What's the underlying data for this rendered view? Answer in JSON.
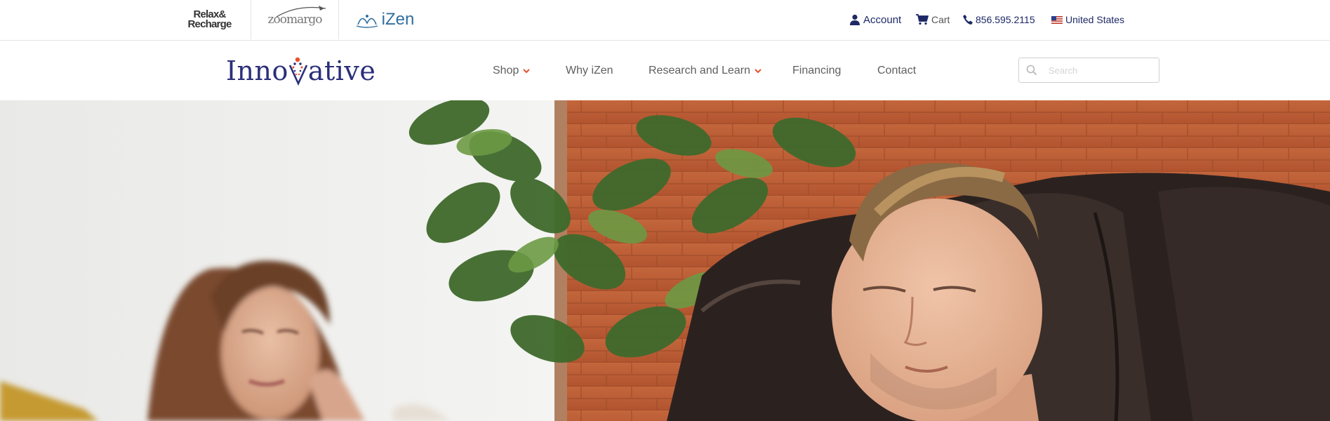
{
  "brands": {
    "relax_line1": "Relax&",
    "relax_line2": "Recharge",
    "zoomarg": "zoomargo",
    "izen": "iZen"
  },
  "utility": {
    "account_label": "Account",
    "cart_label": "Cart",
    "phone": "856.595.2115",
    "country": "United States"
  },
  "logo": {
    "text_left": "Inno",
    "text_right": "ative"
  },
  "nav": {
    "shop": "Shop",
    "why": "Why iZen",
    "research": "Research and Learn",
    "financing": "Financing",
    "contact": "Contact"
  },
  "search": {
    "placeholder": "Search"
  },
  "colors": {
    "brand_navy": "#2a2f7a",
    "accent_orange": "#e8512a",
    "nav_text": "#5f5f5f"
  },
  "icons": {
    "account": "user-icon",
    "cart": "cart-icon",
    "phone": "phone-icon",
    "country": "us-flag-icon",
    "search": "search-icon",
    "dropdown": "chevron-down-icon"
  }
}
